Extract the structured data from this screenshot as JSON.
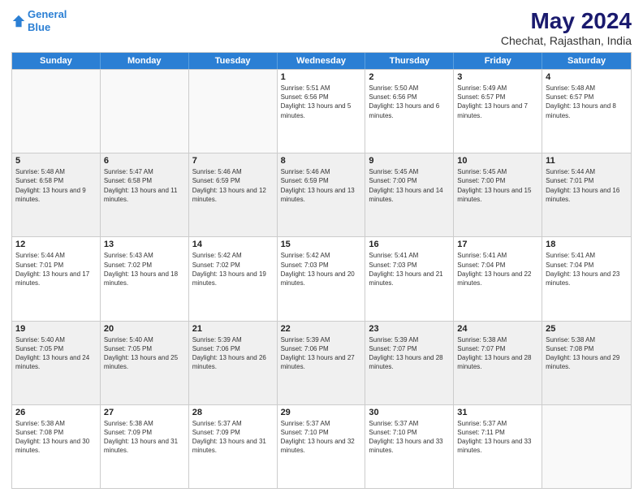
{
  "header": {
    "logo_line1": "General",
    "logo_line2": "Blue",
    "title": "May 2024",
    "subtitle": "Chechat, Rajasthan, India"
  },
  "weekdays": [
    "Sunday",
    "Monday",
    "Tuesday",
    "Wednesday",
    "Thursday",
    "Friday",
    "Saturday"
  ],
  "rows": [
    [
      {
        "day": "",
        "sunrise": "",
        "sunset": "",
        "daylight": "",
        "empty": true
      },
      {
        "day": "",
        "sunrise": "",
        "sunset": "",
        "daylight": "",
        "empty": true
      },
      {
        "day": "",
        "sunrise": "",
        "sunset": "",
        "daylight": "",
        "empty": true
      },
      {
        "day": "1",
        "sunrise": "Sunrise: 5:51 AM",
        "sunset": "Sunset: 6:56 PM",
        "daylight": "Daylight: 13 hours and 5 minutes."
      },
      {
        "day": "2",
        "sunrise": "Sunrise: 5:50 AM",
        "sunset": "Sunset: 6:56 PM",
        "daylight": "Daylight: 13 hours and 6 minutes."
      },
      {
        "day": "3",
        "sunrise": "Sunrise: 5:49 AM",
        "sunset": "Sunset: 6:57 PM",
        "daylight": "Daylight: 13 hours and 7 minutes."
      },
      {
        "day": "4",
        "sunrise": "Sunrise: 5:48 AM",
        "sunset": "Sunset: 6:57 PM",
        "daylight": "Daylight: 13 hours and 8 minutes."
      }
    ],
    [
      {
        "day": "5",
        "sunrise": "Sunrise: 5:48 AM",
        "sunset": "Sunset: 6:58 PM",
        "daylight": "Daylight: 13 hours and 9 minutes."
      },
      {
        "day": "6",
        "sunrise": "Sunrise: 5:47 AM",
        "sunset": "Sunset: 6:58 PM",
        "daylight": "Daylight: 13 hours and 11 minutes."
      },
      {
        "day": "7",
        "sunrise": "Sunrise: 5:46 AM",
        "sunset": "Sunset: 6:59 PM",
        "daylight": "Daylight: 13 hours and 12 minutes."
      },
      {
        "day": "8",
        "sunrise": "Sunrise: 5:46 AM",
        "sunset": "Sunset: 6:59 PM",
        "daylight": "Daylight: 13 hours and 13 minutes."
      },
      {
        "day": "9",
        "sunrise": "Sunrise: 5:45 AM",
        "sunset": "Sunset: 7:00 PM",
        "daylight": "Daylight: 13 hours and 14 minutes."
      },
      {
        "day": "10",
        "sunrise": "Sunrise: 5:45 AM",
        "sunset": "Sunset: 7:00 PM",
        "daylight": "Daylight: 13 hours and 15 minutes."
      },
      {
        "day": "11",
        "sunrise": "Sunrise: 5:44 AM",
        "sunset": "Sunset: 7:01 PM",
        "daylight": "Daylight: 13 hours and 16 minutes."
      }
    ],
    [
      {
        "day": "12",
        "sunrise": "Sunrise: 5:44 AM",
        "sunset": "Sunset: 7:01 PM",
        "daylight": "Daylight: 13 hours and 17 minutes."
      },
      {
        "day": "13",
        "sunrise": "Sunrise: 5:43 AM",
        "sunset": "Sunset: 7:02 PM",
        "daylight": "Daylight: 13 hours and 18 minutes."
      },
      {
        "day": "14",
        "sunrise": "Sunrise: 5:42 AM",
        "sunset": "Sunset: 7:02 PM",
        "daylight": "Daylight: 13 hours and 19 minutes."
      },
      {
        "day": "15",
        "sunrise": "Sunrise: 5:42 AM",
        "sunset": "Sunset: 7:03 PM",
        "daylight": "Daylight: 13 hours and 20 minutes."
      },
      {
        "day": "16",
        "sunrise": "Sunrise: 5:41 AM",
        "sunset": "Sunset: 7:03 PM",
        "daylight": "Daylight: 13 hours and 21 minutes."
      },
      {
        "day": "17",
        "sunrise": "Sunrise: 5:41 AM",
        "sunset": "Sunset: 7:04 PM",
        "daylight": "Daylight: 13 hours and 22 minutes."
      },
      {
        "day": "18",
        "sunrise": "Sunrise: 5:41 AM",
        "sunset": "Sunset: 7:04 PM",
        "daylight": "Daylight: 13 hours and 23 minutes."
      }
    ],
    [
      {
        "day": "19",
        "sunrise": "Sunrise: 5:40 AM",
        "sunset": "Sunset: 7:05 PM",
        "daylight": "Daylight: 13 hours and 24 minutes."
      },
      {
        "day": "20",
        "sunrise": "Sunrise: 5:40 AM",
        "sunset": "Sunset: 7:05 PM",
        "daylight": "Daylight: 13 hours and 25 minutes."
      },
      {
        "day": "21",
        "sunrise": "Sunrise: 5:39 AM",
        "sunset": "Sunset: 7:06 PM",
        "daylight": "Daylight: 13 hours and 26 minutes."
      },
      {
        "day": "22",
        "sunrise": "Sunrise: 5:39 AM",
        "sunset": "Sunset: 7:06 PM",
        "daylight": "Daylight: 13 hours and 27 minutes."
      },
      {
        "day": "23",
        "sunrise": "Sunrise: 5:39 AM",
        "sunset": "Sunset: 7:07 PM",
        "daylight": "Daylight: 13 hours and 28 minutes."
      },
      {
        "day": "24",
        "sunrise": "Sunrise: 5:38 AM",
        "sunset": "Sunset: 7:07 PM",
        "daylight": "Daylight: 13 hours and 28 minutes."
      },
      {
        "day": "25",
        "sunrise": "Sunrise: 5:38 AM",
        "sunset": "Sunset: 7:08 PM",
        "daylight": "Daylight: 13 hours and 29 minutes."
      }
    ],
    [
      {
        "day": "26",
        "sunrise": "Sunrise: 5:38 AM",
        "sunset": "Sunset: 7:08 PM",
        "daylight": "Daylight: 13 hours and 30 minutes."
      },
      {
        "day": "27",
        "sunrise": "Sunrise: 5:38 AM",
        "sunset": "Sunset: 7:09 PM",
        "daylight": "Daylight: 13 hours and 31 minutes."
      },
      {
        "day": "28",
        "sunrise": "Sunrise: 5:37 AM",
        "sunset": "Sunset: 7:09 PM",
        "daylight": "Daylight: 13 hours and 31 minutes."
      },
      {
        "day": "29",
        "sunrise": "Sunrise: 5:37 AM",
        "sunset": "Sunset: 7:10 PM",
        "daylight": "Daylight: 13 hours and 32 minutes."
      },
      {
        "day": "30",
        "sunrise": "Sunrise: 5:37 AM",
        "sunset": "Sunset: 7:10 PM",
        "daylight": "Daylight: 13 hours and 33 minutes."
      },
      {
        "day": "31",
        "sunrise": "Sunrise: 5:37 AM",
        "sunset": "Sunset: 7:11 PM",
        "daylight": "Daylight: 13 hours and 33 minutes."
      },
      {
        "day": "",
        "sunrise": "",
        "sunset": "",
        "daylight": "",
        "empty": true
      }
    ]
  ]
}
